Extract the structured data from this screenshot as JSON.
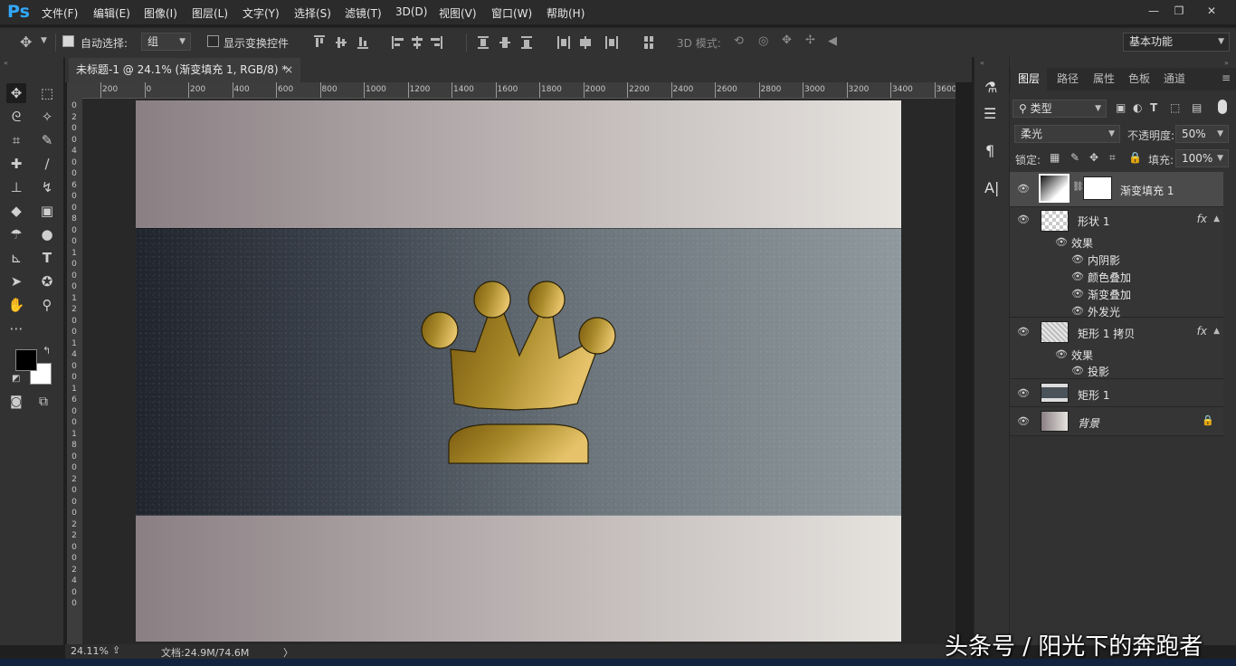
{
  "app": {
    "logo": "Ps"
  },
  "menu": [
    "文件(F)",
    "编辑(E)",
    "图像(I)",
    "图层(L)",
    "文字(Y)",
    "选择(S)",
    "滤镜(T)",
    "3D(D)",
    "视图(V)",
    "窗口(W)",
    "帮助(H)"
  ],
  "window_controls": {
    "minimize": "—",
    "restore": "❐",
    "close": "✕"
  },
  "options": {
    "auto_select_label": "自动选择:",
    "auto_select_checked": true,
    "auto_select_target": "组",
    "show_transform_label": "显示变换控件",
    "show_transform_checked": false,
    "mode_3d_label": "3D 模式:",
    "workspace": "基本功能"
  },
  "document": {
    "tab_title": "未标题-1 @ 24.1% (渐变填充 1, RGB/8) *",
    "close": "×"
  },
  "rulers": {
    "horizontal": [
      "200",
      "0",
      "200",
      "400",
      "600",
      "800",
      "1000",
      "1200",
      "1400",
      "1600",
      "1800",
      "2000",
      "2200",
      "2400",
      "2600",
      "2800",
      "3000",
      "3200",
      "3400",
      "3600"
    ],
    "vertical": [
      "0",
      "2",
      "0",
      "0",
      "4",
      "0",
      "0",
      "6",
      "0",
      "0",
      "8",
      "0",
      "0",
      "1",
      "0",
      "0",
      "0",
      "1",
      "2",
      "0",
      "0",
      "1",
      "4",
      "0",
      "0",
      "1",
      "6",
      "0",
      "0",
      "1",
      "8",
      "0",
      "0",
      "2",
      "0",
      "0",
      "0",
      "2",
      "2",
      "0",
      "0",
      "2",
      "4",
      "0",
      "0"
    ]
  },
  "status": {
    "zoom": "24.11%",
    "doc_info": "文档:24.9M/74.6M",
    "arrow": "〉"
  },
  "panel": {
    "tabs": [
      "图层",
      "路径",
      "属性",
      "色板",
      "通道"
    ],
    "filter_kind": "类型",
    "blend_mode": "柔光",
    "opacity_label": "不透明度:",
    "opacity_value": "50%",
    "lock_label": "锁定:",
    "fill_label": "填充:",
    "fill_value": "100%",
    "layers": [
      {
        "name": "渐变填充 1",
        "selected": true
      },
      {
        "name": "形状 1",
        "fx": "fx",
        "effects_label": "效果",
        "effects": [
          "内阴影",
          "颜色叠加",
          "渐变叠加",
          "外发光"
        ]
      },
      {
        "name": "矩形 1 拷贝",
        "fx": "fx",
        "effects_label": "效果",
        "effects": [
          "投影"
        ]
      },
      {
        "name": "矩形 1"
      },
      {
        "name": "背景",
        "locked": true
      }
    ]
  },
  "watermark": "头条号 / 阳光下的奔跑者",
  "colors": {
    "accent": "#31a8ff",
    "gold_light": "#e6c36a",
    "gold_dark": "#7a5a0f"
  }
}
